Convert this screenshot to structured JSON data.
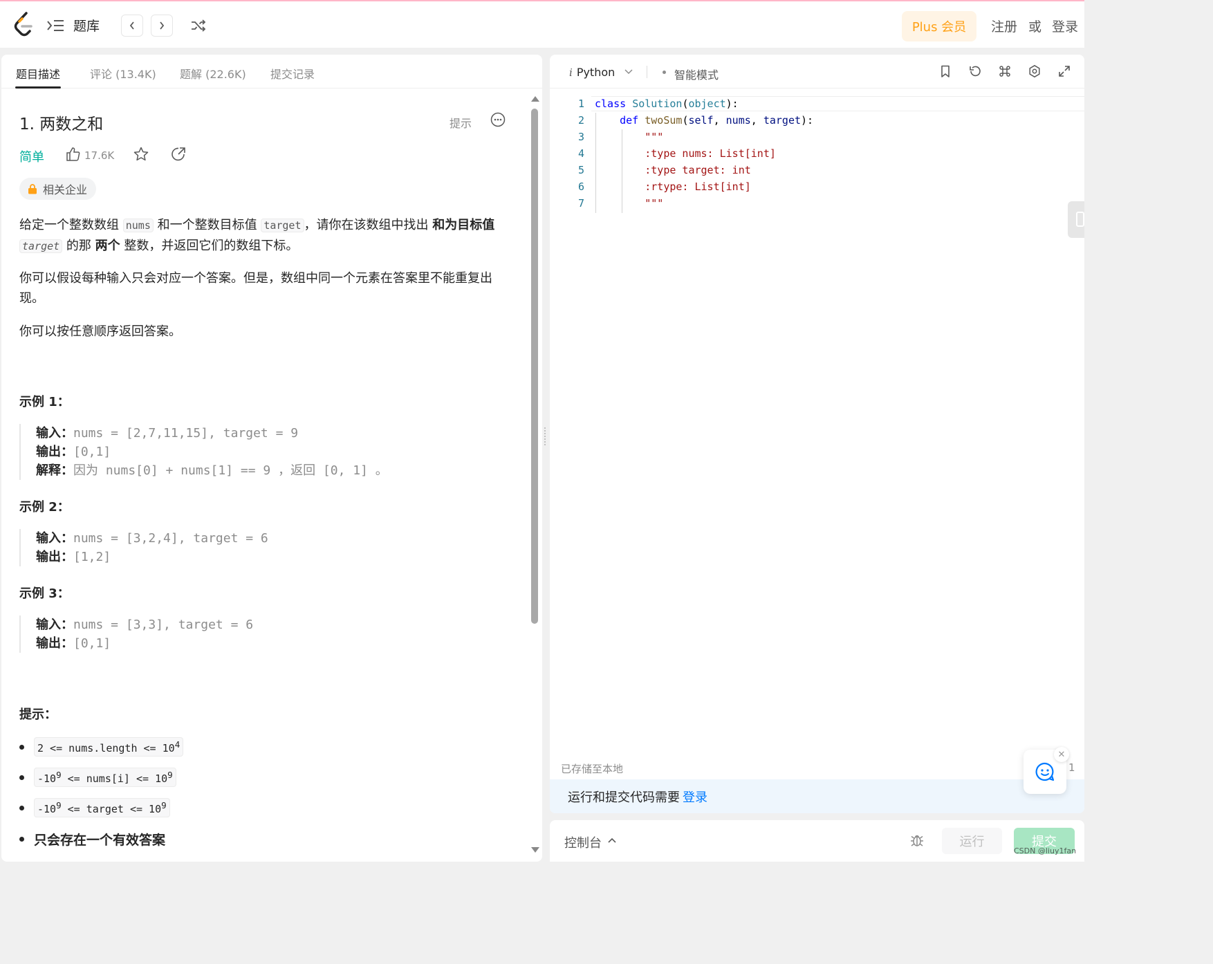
{
  "header": {
    "problem_bank": "题库",
    "plus_label": "Plus 会员",
    "register": "注册",
    "or": "或",
    "login": "登录"
  },
  "left_tabs": [
    "题目描述",
    "评论 (13.4K)",
    "题解 (22.6K)",
    "提交记录"
  ],
  "problem": {
    "title": "1. 两数之和",
    "hint_label": "提示",
    "difficulty": "简单",
    "likes": "17.6K",
    "company_tag": "相关企业",
    "desc1_a": "给定一个整数数组 ",
    "desc1_code1": "nums",
    "desc1_b": " 和一个整数目标值 ",
    "desc1_code2": "target",
    "desc1_c": "，请你在该数组中找出 ",
    "desc1_bold1": "和为目标值",
    "desc1_d": " ",
    "desc1_code3": "target",
    "desc1_e": " 的那 ",
    "desc1_bold2": "两个",
    "desc1_f": " 整数，并返回它们的数组下标。",
    "desc2": "你可以假设每种输入只会对应一个答案。但是，数组中同一个元素在答案里不能重复出现。",
    "desc3": "你可以按任意顺序返回答案。"
  },
  "examples": [
    {
      "title": "示例 1：",
      "input_label": "输入：",
      "input": "nums = [2,7,11,15], target = 9",
      "output_label": "输出：",
      "output": "[0,1]",
      "explain_label": "解释：",
      "explain": "因为 nums[0] + nums[1] == 9 ，返回 [0, 1] 。"
    },
    {
      "title": "示例 2：",
      "input_label": "输入：",
      "input": "nums = [3,2,4], target = 6",
      "output_label": "输出：",
      "output": "[1,2]"
    },
    {
      "title": "示例 3：",
      "input_label": "输入：",
      "input": "nums = [3,3], target = 6",
      "output_label": "输出：",
      "output": "[0,1]"
    }
  ],
  "constraints": {
    "title": "提示：",
    "c1": {
      "pre": "2 <= nums.length <= 10",
      "sup": "4"
    },
    "c2": {
      "a": "-10",
      "sup1": "9",
      "b": " <= nums[i] <= 10",
      "sup2": "9"
    },
    "c3": {
      "a": "-10",
      "sup1": "9",
      "b": " <= target <= 10",
      "sup2": "9"
    },
    "c4": "只会存在一个有效答案"
  },
  "editor": {
    "language": "Python",
    "mode": "智能模式",
    "line_numbers": [
      "1",
      "2",
      "3",
      "4",
      "5",
      "6",
      "7"
    ],
    "code": {
      "l1_kw": "class",
      "l1_cls": "Solution",
      "l1_p1": "(",
      "l1_obj": "object",
      "l1_p2": "):",
      "l2_kw": "def",
      "l2_fn": "twoSum",
      "l2_rest_a": "(",
      "l2_self": "self",
      "l2_c1": ", ",
      "l2_nums": "nums",
      "l2_c2": ", ",
      "l2_target": "target",
      "l2_end": "):",
      "l3": "\"\"\"",
      "l4": ":type nums: List[int]",
      "l5": ":type target: int",
      "l6": ":rtype: List[int]",
      "l7": "\"\"\""
    },
    "saved_status": "已存储至本地",
    "saved_right": "1",
    "login_prompt": "运行和提交代码需要",
    "login_link": "登录"
  },
  "console": {
    "label": "控制台",
    "run": "运行",
    "submit": "提交"
  },
  "watermark": "CSDN @liuy1fan",
  "colors": {
    "brand_orange": "#ffa116",
    "easy_green": "#00af9b",
    "link_blue": "#007aff"
  }
}
